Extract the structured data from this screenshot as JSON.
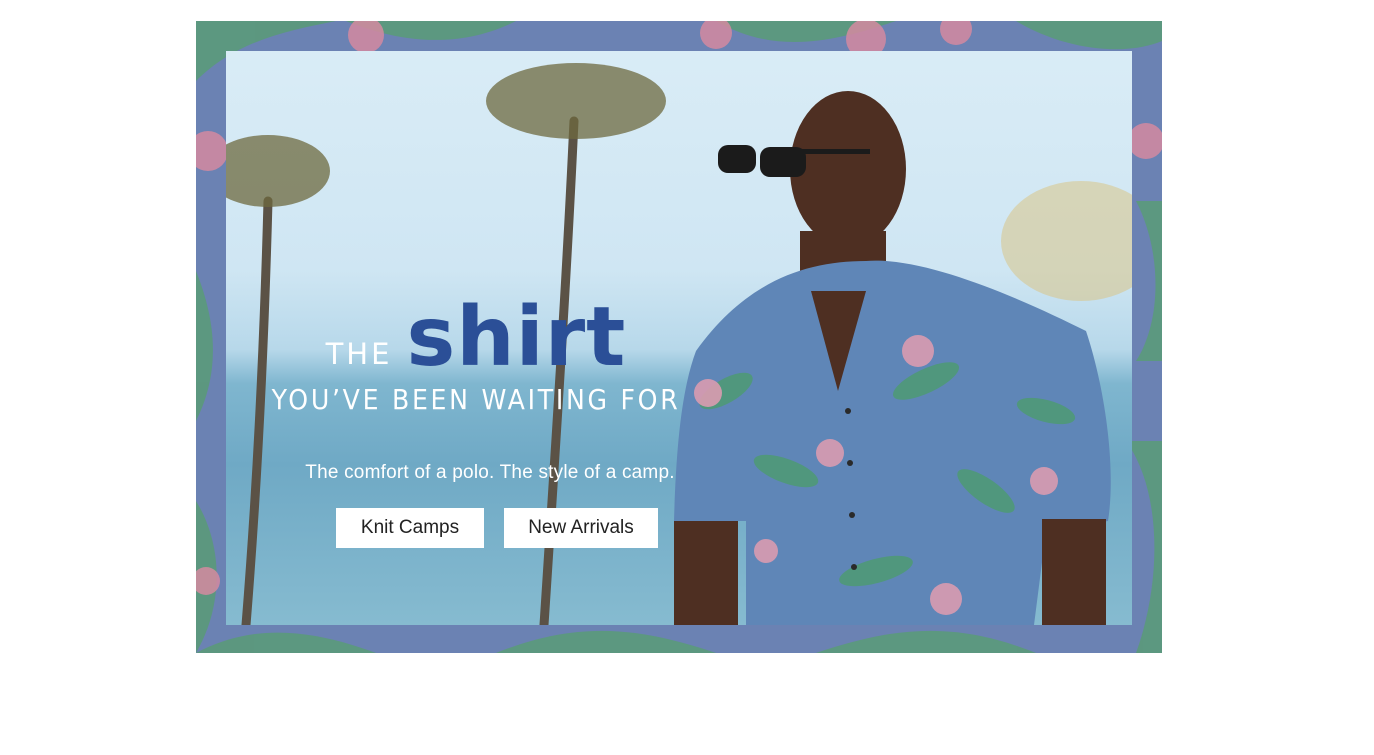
{
  "hero": {
    "headline_the": "THE",
    "headline_shirt": "shirt",
    "headline_sub": "YOU’VE BEEN WAITING FOR",
    "tagline": "The comfort of a polo. The style of a camp.",
    "buttons": [
      {
        "label": "Knit Camps"
      },
      {
        "label": "New Arrivals"
      }
    ]
  },
  "colors": {
    "frame": "#6b82b3",
    "accent": "#2b4f97",
    "shirt_base": "#5f86b7"
  }
}
